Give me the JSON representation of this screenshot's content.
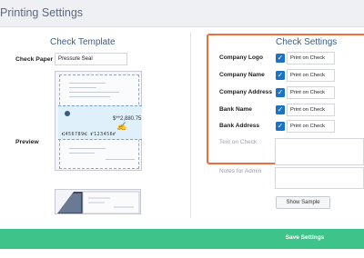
{
  "header": {
    "title": "Printing Settings"
  },
  "check_template": {
    "title": "Check Template",
    "check_paper_label": "Check Paper",
    "check_paper_value": "Pressure Seal",
    "preview_label": "Preview",
    "sample_amount": "$**2,880.75",
    "sample_micr": "⑆456789⑆ ⑈123456⑈"
  },
  "check_settings": {
    "title": "Check Settings",
    "rows": [
      {
        "label": "Company Logo",
        "checked": true,
        "value": "Print on Check"
      },
      {
        "label": "Company Name",
        "checked": true,
        "value": "Print on Check"
      },
      {
        "label": "Company Address",
        "checked": true,
        "value": "Print on Check"
      },
      {
        "label": "Bank Name",
        "checked": true,
        "value": "Print on Check"
      },
      {
        "label": "Bank Address",
        "checked": true,
        "value": "Print on Check"
      }
    ],
    "text_on_check_label": "Text on Check",
    "notes_for_admin_label": "Notes for Admin",
    "show_sample_label": "Show Sample"
  },
  "footer": {
    "save_label": "Save Settings"
  },
  "colors": {
    "accent": "#1a73c9",
    "save": "#3ec48a",
    "highlight": "#f26b3a"
  }
}
